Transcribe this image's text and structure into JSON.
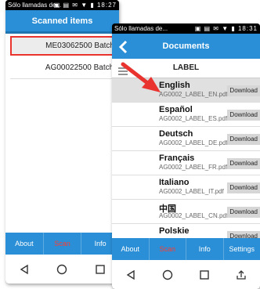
{
  "phone1": {
    "status": {
      "carrier": "Sólo llamadas de...",
      "icons": "▣ ▤ ✉ ▼ ▮",
      "time": "18:27"
    },
    "title": "Scanned items",
    "items": [
      {
        "label": "ME03062500 Batch"
      },
      {
        "label": "AG00022500 Batch:"
      }
    ],
    "nav": [
      "About",
      "Scan",
      "Info"
    ]
  },
  "phone2": {
    "status": {
      "carrier": "Sólo llamadas de...",
      "icons": "▣ ▤ ✉ ▼ ▮",
      "time": "18:31"
    },
    "title": "Documents",
    "section": "LABEL",
    "documents": [
      {
        "language": "English",
        "file": "AG0002_LABEL_EN.pdf",
        "action": "Download"
      },
      {
        "language": "Español",
        "file": "AG0002_LABEL_ES.pdf",
        "action": "Download"
      },
      {
        "language": "Deutsch",
        "file": "AG0002_LABEL_DE.pdf",
        "action": "Download"
      },
      {
        "language": "Français",
        "file": "AG0002_LABEL_FR.pdf",
        "action": "Download"
      },
      {
        "language": "Italiano",
        "file": "AG0002_LABEL_IT.pdf",
        "action": "Download"
      },
      {
        "language": "中国",
        "file": "AG0002_LABEL_CN.pdf",
        "action": "Download"
      },
      {
        "language": "Polskie",
        "file": "",
        "action": "Download"
      }
    ],
    "nav": [
      "About",
      "Scan",
      "Info",
      "Settings"
    ]
  },
  "colors": {
    "primary": "#2a8fd6",
    "highlight": "#e8332f",
    "active_tab": "#ff3b30",
    "selected_row": "#e0e0e0"
  }
}
